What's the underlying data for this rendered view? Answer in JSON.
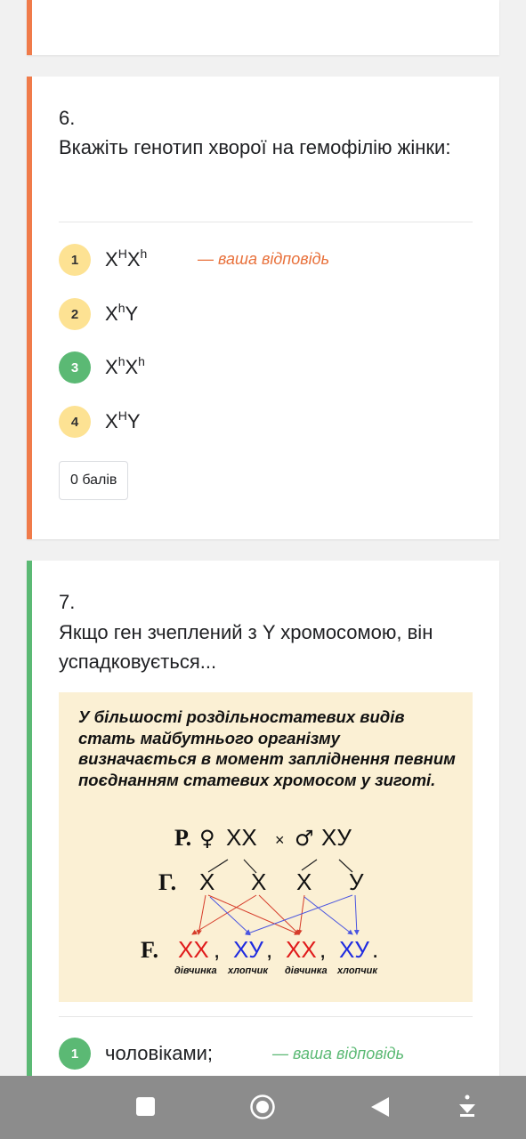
{
  "question6": {
    "number": "6.",
    "text": "Вкажіть генотип хворої на гемофілію жінки:",
    "options": [
      {
        "num": "1",
        "base1": "X",
        "sup1": "H",
        "base2": "X",
        "sup2": "h"
      },
      {
        "num": "2",
        "base1": "X",
        "sup1": "h",
        "base2": "Y",
        "sup2": ""
      },
      {
        "num": "3",
        "base1": "X",
        "sup1": "h",
        "base2": "X",
        "sup2": "h"
      },
      {
        "num": "4",
        "base1": "X",
        "sup1": "H",
        "base2": "Y",
        "sup2": ""
      }
    ],
    "your_answer": "— ваша відповідь",
    "score": "0 балів"
  },
  "question7": {
    "number": "7.",
    "text": "Якщо ген зчеплений з Y хромосомою, він успадковується...",
    "figure": {
      "text": "У більшості роздільностатевих видів стать майбутнього організму визначається в момент запліднення певним поєднанням статевих хромосом у зиготі.",
      "p_label": "Р.",
      "female_sign": "♀",
      "female_genotype": "ХХ",
      "cross": "×",
      "male_sign": "♂",
      "male_genotype": "ХУ",
      "g_label": "Г.",
      "gametes": [
        "Х",
        "Х",
        "Х",
        "У"
      ],
      "f_label": "F.",
      "offspring": [
        {
          "genotype": "ХХ",
          "sep": ",",
          "label": "дівчинка"
        },
        {
          "genotype": "ХУ",
          "sep": ",",
          "label": "хлопчик"
        },
        {
          "genotype": "ХХ",
          "sep": ",",
          "label": "дівчинка"
        },
        {
          "genotype": "ХУ",
          "sep": ".",
          "label": "хлопчик"
        }
      ]
    },
    "options": [
      {
        "num": "1",
        "label": "чоловіками;"
      }
    ],
    "your_answer": "— ваша відповідь"
  },
  "colors": {
    "wrong_stripe": "#f07b4a",
    "correct_stripe": "#5bb974",
    "badge_yellow": "#fde293",
    "badge_green": "#5bb974",
    "female_red": "#e01b1b",
    "male_blue": "#1f2be0",
    "figure_bg": "#fbf0d4",
    "navbar": "#8c8c8c"
  },
  "navbar": {
    "icons": [
      "recent-apps-icon",
      "home-icon",
      "back-icon",
      "assistant-icon"
    ]
  }
}
